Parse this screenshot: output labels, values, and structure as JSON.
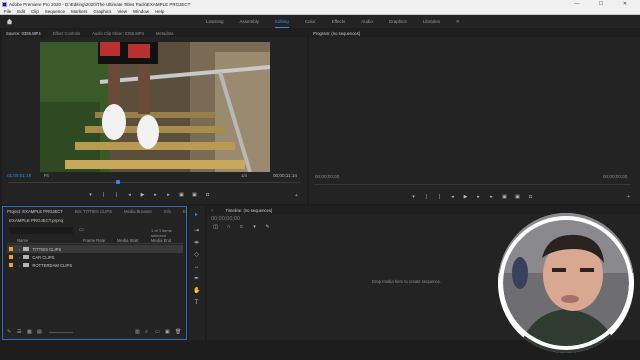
{
  "window": {
    "title": "Adobe Premiere Pro 2020 - D:\\Editing\\2020\\The Ultimate Titles Pack\\EXAMPLE PROJECT",
    "controls": [
      "—",
      "☐",
      "✕"
    ]
  },
  "menu": [
    "File",
    "Edit",
    "Clip",
    "Sequence",
    "Markers",
    "Graphics",
    "View",
    "Window",
    "Help"
  ],
  "workspaces": {
    "tabs": [
      "Learning",
      "Assembly",
      "Editing",
      "Color",
      "Effects",
      "Audio",
      "Graphics",
      "Libraries"
    ],
    "active": "Editing",
    "more": "»"
  },
  "source_monitor": {
    "tabs": [
      "Source: 0355.MP4",
      "Effect Controls",
      "Audio Clip Mixer: 0355.MP4",
      "Metadata"
    ],
    "timecode_in": "01;09;01;18",
    "fit": "Fit",
    "resolution": "1/4",
    "duration": "00;00;11;14"
  },
  "program_monitor": {
    "tabs": [
      "Program: (no sequences)"
    ],
    "timecode_left": "00;00;00;00",
    "timecode_right": "00;00;00;00"
  },
  "project_panel": {
    "tabs": [
      "Project: EXAMPLE PROJECT",
      "Bin: TITTIES CLIPS",
      "Media Browser",
      "Info",
      "Ef"
    ],
    "more": "»",
    "project_file": "EXAMPLE PROJECT.prproj",
    "items_selected": "1 of 3 items selected",
    "columns": [
      "Name",
      "Frame Rate",
      "Media Start",
      "Media End"
    ],
    "rows": [
      {
        "label": "TITTIES CLIPS",
        "selected": true
      },
      {
        "label": "CAR CLIPS",
        "selected": false
      },
      {
        "label": "ROTTERDAM CLIPS",
        "selected": false
      }
    ],
    "folder_color": "#e8a33a"
  },
  "timeline": {
    "tabs": [
      "Timeline: (no sequences)"
    ],
    "timecode": "00;00;00;00",
    "empty_message": "Drop media here to create sequence."
  },
  "colors": {
    "accent": "#2d8ceb",
    "panel_bg": "#232323",
    "app_bg": "#1d1d1d"
  }
}
